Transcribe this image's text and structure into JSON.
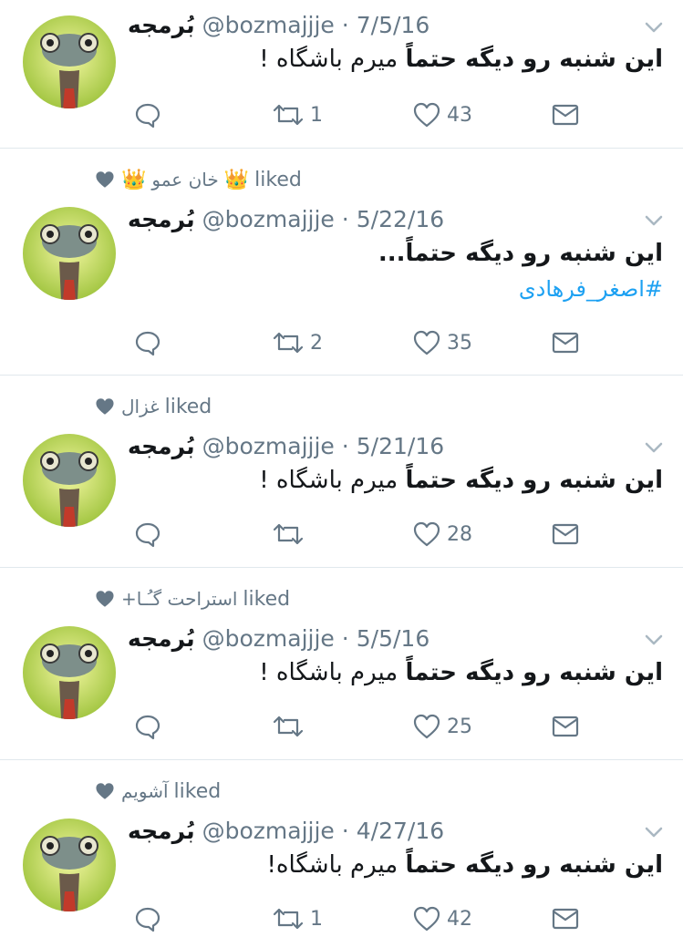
{
  "tweets": [
    {
      "liked_by": null,
      "display_name": "بُرمجه",
      "handle": "@bozmajjje",
      "date": "7/5/16",
      "text_bold": "این شنبه رو دیگه حتماً",
      "text_rest": " میرم باشگاه !",
      "hashtag": "",
      "retweets": "1",
      "likes": "43"
    },
    {
      "liked_by": "خان عمو",
      "liked_crowns": true,
      "liked_label": "liked",
      "display_name": "بُرمجه",
      "handle": "@bozmajjje",
      "date": "5/22/16",
      "text_bold": "این شنبه رو دیگه حتماً...",
      "text_rest": "",
      "hashtag": "#اصغر_فرهادی",
      "retweets": "2",
      "likes": "35"
    },
    {
      "liked_by": "غزال",
      "liked_crowns": false,
      "liked_label": "liked",
      "display_name": "بُرمجه",
      "handle": "@bozmajjje",
      "date": "5/21/16",
      "text_bold": "این شنبه رو دیگه حتماً",
      "text_rest": " میرم باشگاه !",
      "hashtag": "",
      "retweets": "",
      "likes": "28"
    },
    {
      "liked_by": "استراحت گـُـا+",
      "liked_crowns": false,
      "liked_label": "liked",
      "display_name": "بُرمجه",
      "handle": "@bozmajjje",
      "date": "5/5/16",
      "text_bold": "این شنبه رو دیگه حتماً",
      "text_rest": " میرم باشگاه !",
      "hashtag": "",
      "retweets": "",
      "likes": "25"
    },
    {
      "liked_by": "آشویم",
      "liked_crowns": false,
      "liked_label": "liked",
      "display_name": "بُرمجه",
      "handle": "@bozmajjje",
      "date": "4/27/16",
      "text_bold": "این شنبه رو دیگه حتماً",
      "text_rest": " میرم باشگاه!",
      "hashtag": "",
      "retweets": "1",
      "likes": "42"
    }
  ],
  "separator": "·",
  "colors": {
    "text_primary": "#14171a",
    "text_secondary": "#657786",
    "link": "#1da1f2",
    "border": "#e1e8ed",
    "heart": "#657786"
  },
  "icons": [
    "chevron-down-icon",
    "reply-icon",
    "retweet-icon",
    "like-icon",
    "direct-message-icon",
    "liked-heart-icon",
    "crown-icon"
  ]
}
